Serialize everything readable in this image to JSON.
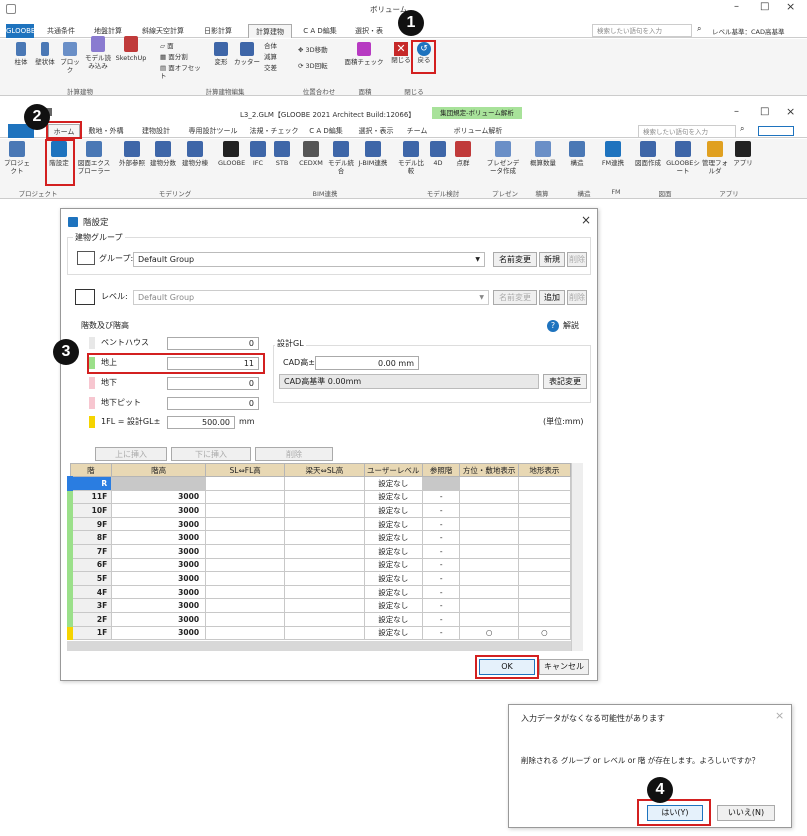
{
  "top_window": {
    "title": "ボリューム",
    "tabs": [
      "GLOOBE",
      "共通条件",
      "地盤計算",
      "斜線天空計算",
      "日影計算",
      "計算建物",
      "C A D編集",
      "選択・表"
    ],
    "buttons": [
      {
        "label": "柱体"
      },
      {
        "label": "壁状体"
      },
      {
        "label": "ブロック"
      },
      {
        "label": "モデル読み込み"
      },
      {
        "label": "SketchUp"
      },
      {
        "label": "面"
      },
      {
        "label": "面分割"
      },
      {
        "label": "面オフセット"
      },
      {
        "label": "変形"
      },
      {
        "label": "カッター"
      },
      {
        "label": "合体"
      },
      {
        "label": "減算"
      },
      {
        "label": "交差"
      },
      {
        "label": "3D移動"
      },
      {
        "label": "3D回転"
      },
      {
        "label": "面積チェック"
      },
      {
        "label": "閉じる"
      },
      {
        "label": "戻る"
      }
    ],
    "groups": [
      "計算建物",
      "計算建物編集",
      "位置合わせ",
      "面積",
      "閉じる"
    ],
    "search_placeholder": "検索したい語句を入力",
    "level_text": "レベル基準：CAD高基準"
  },
  "main_window": {
    "title": "L3_2.GLM【GLOOBE 2021 Architect Build:12066】",
    "context_tab": "集団規定-ボリューム解析",
    "tabs": [
      "ホーム",
      "敷地・外構",
      "建物設計",
      "専用設計ツール",
      "法規・チェック",
      "C A D編集",
      "選択・表示",
      "チーム",
      "ボリューム解析"
    ],
    "buttons": [
      {
        "label": "プロジェクト"
      },
      {
        "label": "階設定"
      },
      {
        "label": "図面エクスプローラー"
      },
      {
        "label": "外部参照"
      },
      {
        "label": "建物分数"
      },
      {
        "label": "建物分棟"
      },
      {
        "label": "GLOOBE"
      },
      {
        "label": "IFC"
      },
      {
        "label": "STB"
      },
      {
        "label": "CEDXM"
      },
      {
        "label": "モデル統合"
      },
      {
        "label": "J-BIM連携"
      },
      {
        "label": "モデル比較"
      },
      {
        "label": "4D"
      },
      {
        "label": "点群"
      },
      {
        "label": "プレゼンデータ作成"
      },
      {
        "label": "概算数量"
      },
      {
        "label": "構造"
      },
      {
        "label": "FM連携"
      },
      {
        "label": "図面作成"
      },
      {
        "label": "GLOOBEシート"
      },
      {
        "label": "管理フォルダ"
      },
      {
        "label": "アプリ"
      }
    ],
    "groups": [
      "プロジェクト",
      "モデリング",
      "BIM連携",
      "モデル検討",
      "プレゼン",
      "積算",
      "構造",
      "FM",
      "図面",
      "アプリ"
    ],
    "search_placeholder": "検索したい語句を入力"
  },
  "dialog": {
    "title": "階設定",
    "building_group_label": "建物グループ",
    "group_label": "グループ:",
    "group_value": "Default Group",
    "rename": "名前変更",
    "new": "新規",
    "delete": "削除",
    "level_label": "レベル:",
    "level_value": "Default Group",
    "add": "追加",
    "floors_label": "階数及び階高",
    "help": "解説",
    "penthouse_label": "ペントハウス",
    "penthouse_value": "0",
    "above_label": "地上",
    "above_value": "11",
    "below_label": "地下",
    "below_value": "0",
    "pit_label": "地下ピット",
    "pit_value": "0",
    "fl_label": "1FL = 設計GL±",
    "fl_value": "500.00",
    "unit_mm": "mm",
    "design_gl_label": "設計GL",
    "cad_height_label": "CAD高±",
    "cad_height_value": "0.00",
    "cad_base_text": "CAD高基準  0.00mm",
    "notation_change": "表記変更",
    "unit_note": "(単位:mm)",
    "insert_above": "上に挿入",
    "insert_below": "下に挿入",
    "row_delete": "削除",
    "columns": [
      "階",
      "階高",
      "SL⇔FL高",
      "梁天⇔SL高",
      "ユーザーレベル",
      "参照階",
      "方位・敷地表示",
      "地形表示"
    ],
    "rows": [
      {
        "floor": "R",
        "height": "",
        "user": "設定なし",
        "ref": "",
        "site": "",
        "terrain": ""
      },
      {
        "floor": "11F",
        "height": "3000",
        "user": "設定なし",
        "ref": "-",
        "site": "",
        "terrain": ""
      },
      {
        "floor": "10F",
        "height": "3000",
        "user": "設定なし",
        "ref": "-",
        "site": "",
        "terrain": ""
      },
      {
        "floor": "9F",
        "height": "3000",
        "user": "設定なし",
        "ref": "-",
        "site": "",
        "terrain": ""
      },
      {
        "floor": "8F",
        "height": "3000",
        "user": "設定なし",
        "ref": "-",
        "site": "",
        "terrain": ""
      },
      {
        "floor": "7F",
        "height": "3000",
        "user": "設定なし",
        "ref": "-",
        "site": "",
        "terrain": ""
      },
      {
        "floor": "6F",
        "height": "3000",
        "user": "設定なし",
        "ref": "-",
        "site": "",
        "terrain": ""
      },
      {
        "floor": "5F",
        "height": "3000",
        "user": "設定なし",
        "ref": "-",
        "site": "",
        "terrain": ""
      },
      {
        "floor": "4F",
        "height": "3000",
        "user": "設定なし",
        "ref": "-",
        "site": "",
        "terrain": ""
      },
      {
        "floor": "3F",
        "height": "3000",
        "user": "設定なし",
        "ref": "-",
        "site": "",
        "terrain": ""
      },
      {
        "floor": "2F",
        "height": "3000",
        "user": "設定なし",
        "ref": "-",
        "site": "",
        "terrain": ""
      },
      {
        "floor": "1F",
        "height": "3000",
        "user": "設定なし",
        "ref": "-",
        "site": "○",
        "terrain": "○"
      }
    ],
    "ok": "OK",
    "cancel": "キャンセル"
  },
  "confirm": {
    "title": "入力データがなくなる可能性があります",
    "message": "削除される グループ or レベル or 階 が存在します。よろしいですか？",
    "yes": "はい(Y)",
    "no": "いいえ(N)"
  },
  "callouts": [
    "1",
    "2",
    "3",
    "4"
  ],
  "colors": {
    "accent": "#1e73be",
    "red": "#d32020",
    "header": "#e8d8b4",
    "green": "#9be08a",
    "pink": "#f7c6d0",
    "yellow": "#f5d400"
  }
}
